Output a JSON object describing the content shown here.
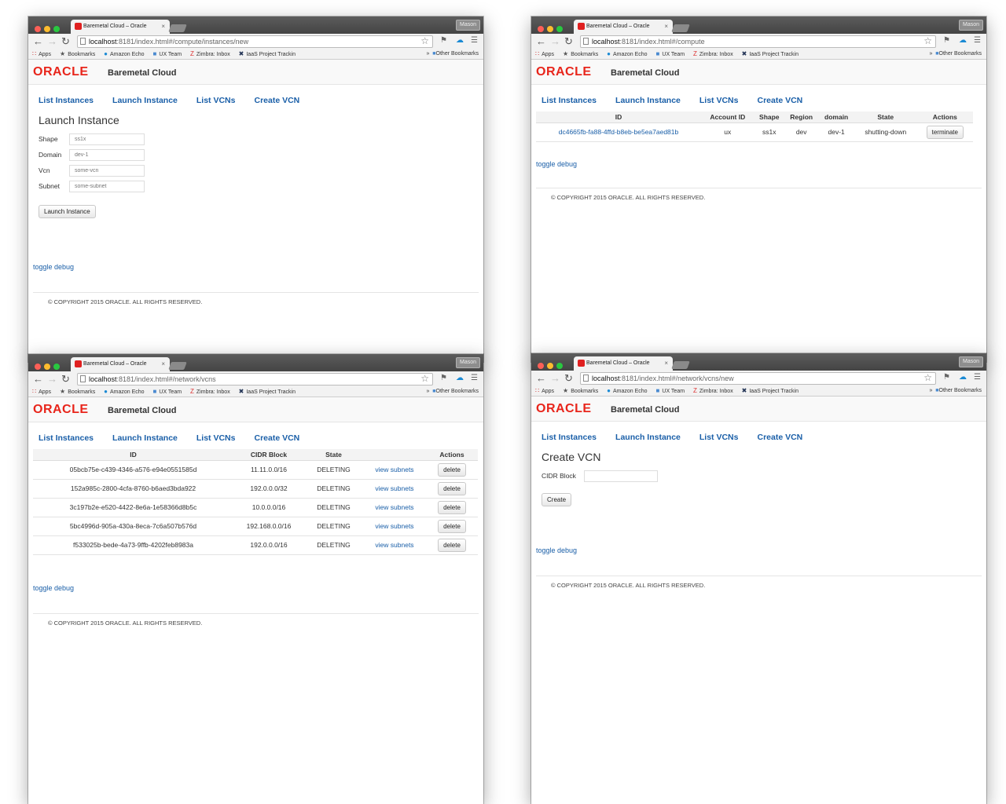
{
  "browser": {
    "tab_title": "Baremetal Cloud – Oracle",
    "tab_close": "×",
    "user_button": "Mason",
    "host": "localhost",
    "bookmarks": [
      "Apps",
      "Bookmarks",
      "Amazon Echo",
      "UX Team",
      "Zimbra: Inbox",
      "IaaS Project Trackin"
    ],
    "bookmark_overflow": "»",
    "other_bookmarks": "Other Bookmarks"
  },
  "app": {
    "logo": "ORACLE",
    "product": "Baremetal Cloud",
    "nav": [
      "List Instances",
      "Launch Instance",
      "List VCNs",
      "Create VCN"
    ],
    "toggle_debug": "toggle debug",
    "copyright": "© COPYRIGHT 2015 ORACLE. ALL RIGHTS RESERVED."
  },
  "windows": {
    "launch": {
      "url_rest": ":8181/index.html#/compute/instances/new",
      "title": "Launch Instance",
      "fields": [
        {
          "label": "Shape",
          "placeholder": "ss1x"
        },
        {
          "label": "Domain",
          "placeholder": "dev-1"
        },
        {
          "label": "Vcn",
          "placeholder": "some-vcn"
        },
        {
          "label": "Subnet",
          "placeholder": "some-subnet"
        }
      ],
      "submit": "Launch Instance"
    },
    "compute": {
      "url_rest": ":8181/index.html#/compute",
      "headers": [
        "ID",
        "Account ID",
        "Shape",
        "Region",
        "domain",
        "State",
        "Actions"
      ],
      "rows": [
        {
          "id": "dc4665fb-fa88-4ffd-b8eb-be5ea7aed81b",
          "account": "ux",
          "shape": "ss1x",
          "region": "dev",
          "domain": "dev-1",
          "state": "shutting-down",
          "action": "terminate"
        }
      ]
    },
    "vcns": {
      "url_rest": ":8181/index.html#/network/vcns",
      "headers": [
        "ID",
        "CIDR Block",
        "State",
        "",
        "Actions"
      ],
      "rows": [
        {
          "id": "05bcb75e-c439-4346-a576-e94e0551585d",
          "cidr": "11.11.0.0/16",
          "state": "DELETING",
          "link": "view subnets",
          "action": "delete"
        },
        {
          "id": "152a985c-2800-4cfa-8760-b6aed3bda922",
          "cidr": "192.0.0.0/32",
          "state": "DELETING",
          "link": "view subnets",
          "action": "delete"
        },
        {
          "id": "3c197b2e-e520-4422-8e6a-1e58366d8b5c",
          "cidr": "10.0.0.0/16",
          "state": "DELETING",
          "link": "view subnets",
          "action": "delete"
        },
        {
          "id": "5bc4996d-905a-430a-8eca-7c6a507b576d",
          "cidr": "192.168.0.0/16",
          "state": "DELETING",
          "link": "view subnets",
          "action": "delete"
        },
        {
          "id": "f533025b-bede-4a73-9ffb-4202feb8983a",
          "cidr": "192.0.0.0/16",
          "state": "DELETING",
          "link": "view subnets",
          "action": "delete"
        }
      ]
    },
    "newvcn": {
      "url_rest": ":8181/index.html#/network/vcns/new",
      "title": "Create VCN",
      "field_label": "CIDR Block",
      "submit": "Create"
    }
  }
}
